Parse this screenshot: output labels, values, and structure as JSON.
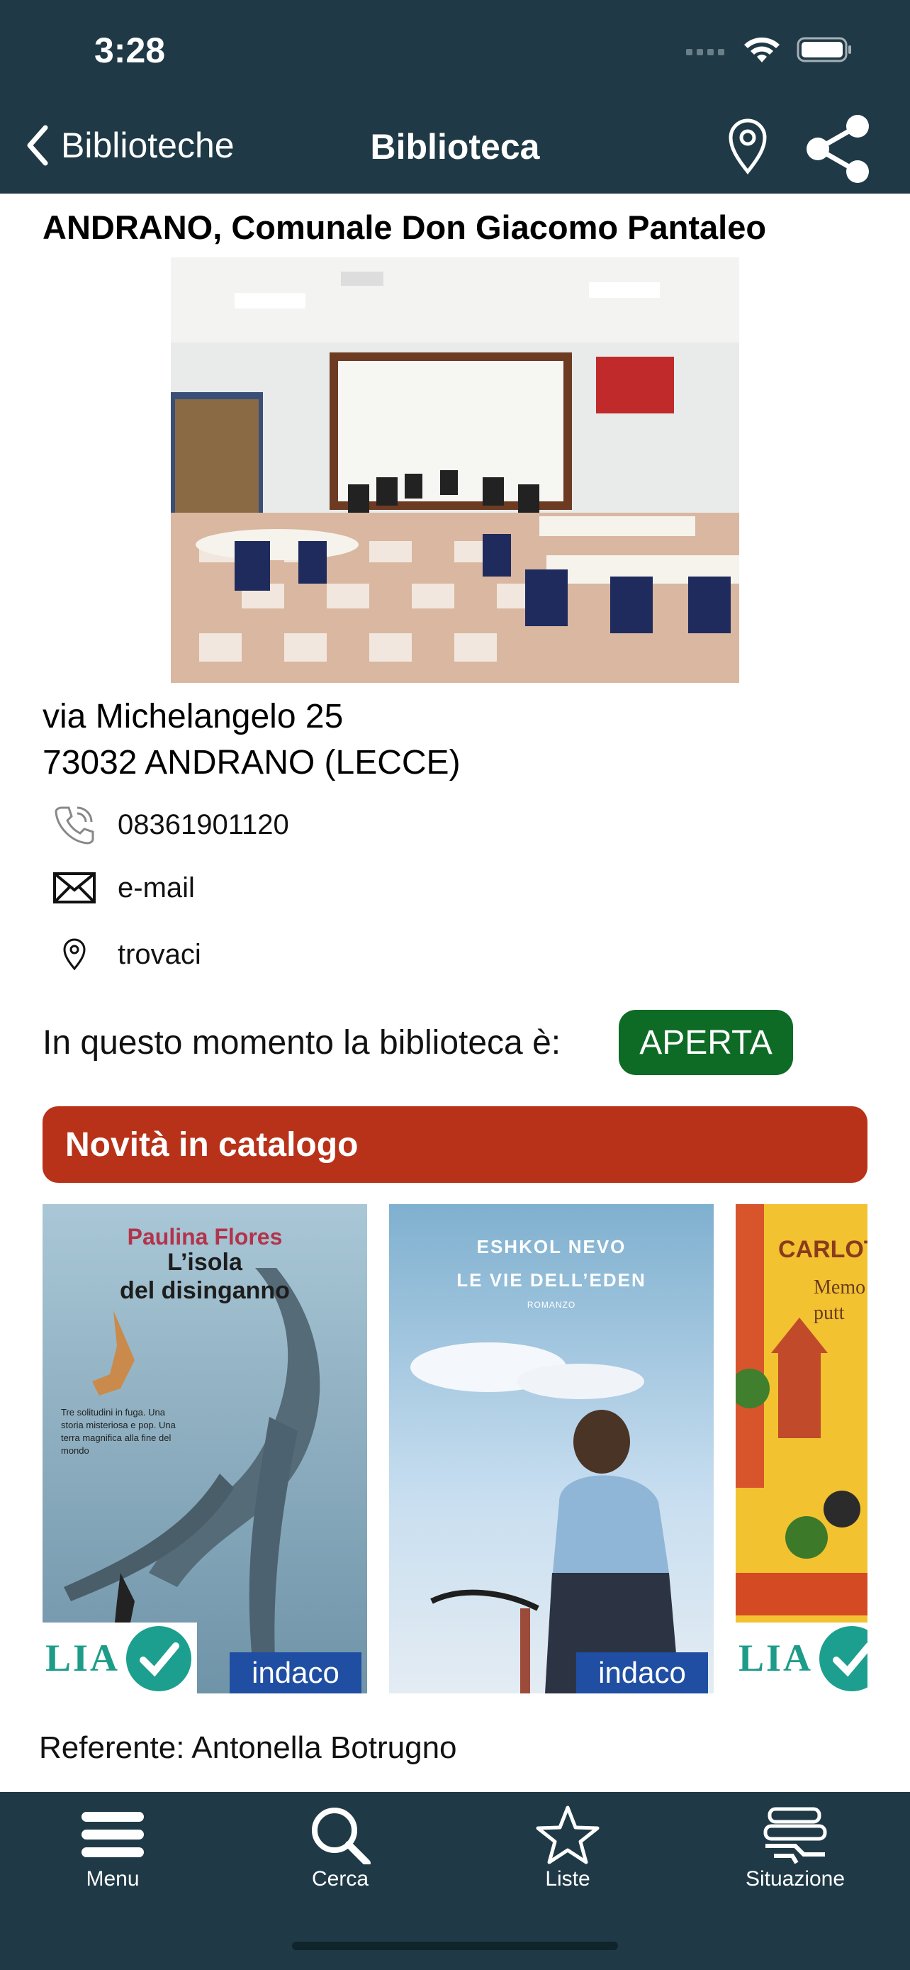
{
  "status": {
    "time": "3:28"
  },
  "nav": {
    "back_label": "Biblioteche",
    "title": "Biblioteca"
  },
  "library": {
    "name": "ANDRANO, Comunale Don Giacomo Pantaleo",
    "address_line1": "via Michelangelo 25",
    "address_line2": "73032 ANDRANO (LECCE)",
    "phone": "08361901120",
    "email_label": "e-mail",
    "map_label": "trovaci",
    "open_text": "In questo momento la biblioteca è:",
    "open_status": "APERTA",
    "referent": "Referente: Antonella Botrugno"
  },
  "news": {
    "header": "Novità in catalogo",
    "books": [
      {
        "author": "Paulina Flores",
        "title_line1": "L’isola",
        "title_line2": "del disinganno",
        "blurb": "Tre solitudini in fuga. Una storia misteriosa e pop. Una terra magnifica alla fine del mondo",
        "badge_lia": "LIA",
        "badge_indaco": "indaco"
      },
      {
        "author": "ESHKOL NEVO",
        "title": "LE VIE DELL’EDEN",
        "subtitle": "ROMANZO",
        "badge_indaco": "indaco"
      },
      {
        "author": "CARLOT",
        "subtitle_line1": "Memo",
        "subtitle_line2": "putt",
        "badge_lia": "LIA"
      }
    ]
  },
  "tabs": [
    {
      "label": "Menu",
      "icon": "menu-icon"
    },
    {
      "label": "Cerca",
      "icon": "search-icon"
    },
    {
      "label": "Liste",
      "icon": "star-icon"
    },
    {
      "label": "Situazione",
      "icon": "books-icon"
    }
  ],
  "colors": {
    "bar_bg": "#1f3a46",
    "news_header": "#b83219",
    "open_badge": "#0e6b26"
  }
}
